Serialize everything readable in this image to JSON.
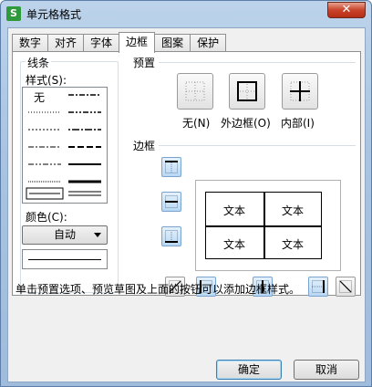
{
  "window": {
    "title": "单元格格式",
    "app_icon_glyph": "S",
    "close_glyph": "✕"
  },
  "tabs": [
    {
      "label": "数字"
    },
    {
      "label": "对齐"
    },
    {
      "label": "字体"
    },
    {
      "label": "边框",
      "active": true
    },
    {
      "label": "图案"
    },
    {
      "label": "保护"
    }
  ],
  "line": {
    "group_title": "线条",
    "style_label": "样式(S):",
    "none_label": "无",
    "color_label": "颜色(C):",
    "color_value": "自动"
  },
  "presets": {
    "section_title": "预置",
    "items": [
      {
        "label": "无(N)",
        "icon": "no-border-icon"
      },
      {
        "label": "外边框(O)",
        "icon": "outline-border-icon"
      },
      {
        "label": "内部(I)",
        "icon": "inside-border-icon"
      }
    ]
  },
  "border": {
    "section_title": "边框",
    "preview_cells": [
      "文本",
      "文本",
      "文本",
      "文本"
    ]
  },
  "hint": "单击预置选项、预览草图及上面的按钮可以添加边框样式。",
  "buttons": {
    "ok": "确定",
    "cancel": "取消"
  },
  "colors": {
    "accent": "#7aa3cf",
    "close": "#c9432a",
    "title_bar": "#a8c4e2"
  }
}
